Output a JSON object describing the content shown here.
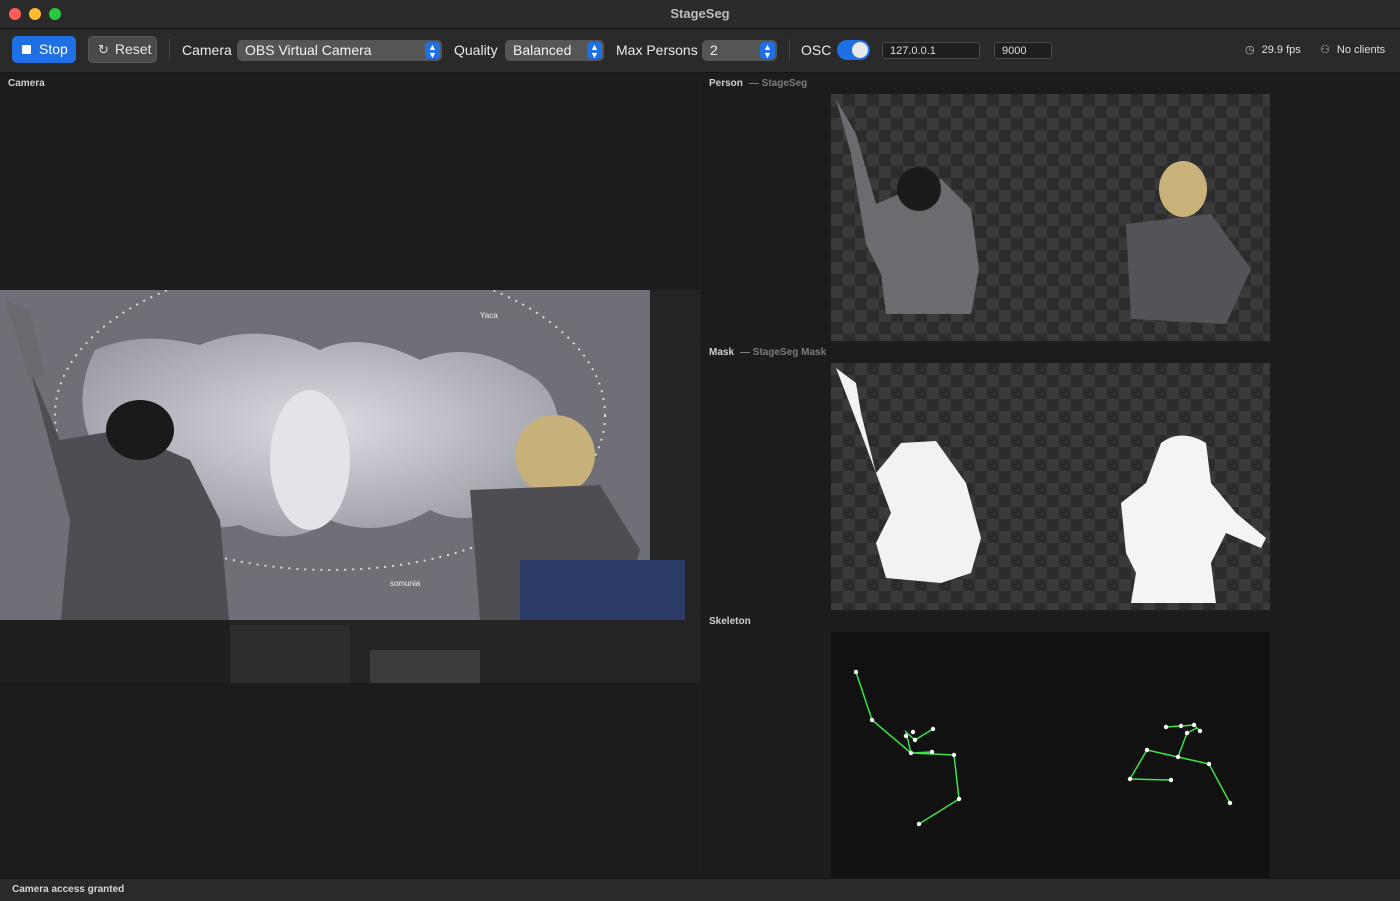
{
  "window": {
    "title": "StageSeg"
  },
  "toolbar": {
    "stop_label": "Stop",
    "reset_label": "Reset",
    "camera_label": "Camera",
    "camera_value": "OBS Virtual Camera",
    "quality_label": "Quality",
    "quality_value": "Balanced",
    "max_persons_label": "Max Persons",
    "max_persons_value": "2",
    "osc_label": "OSC",
    "osc_enabled": true,
    "osc_host": "127.0.0.1",
    "osc_port": "9000",
    "fps": "29.9 fps",
    "clients": "No clients"
  },
  "panels": {
    "camera": {
      "label": "Camera"
    },
    "person": {
      "label": "Person",
      "sub": "— StageSeg"
    },
    "mask": {
      "label": "Mask",
      "sub": "— StageSeg Mask"
    },
    "skeleton": {
      "label": "Skeleton"
    }
  },
  "camera_overlay": {
    "name_left": "Yaca",
    "name_right": "somunia"
  },
  "status": {
    "message": "Camera access granted"
  },
  "colors": {
    "accent": "#1f6fe5",
    "skeleton_line": "#3fe04a",
    "skeleton_joint": "#ffffff"
  }
}
